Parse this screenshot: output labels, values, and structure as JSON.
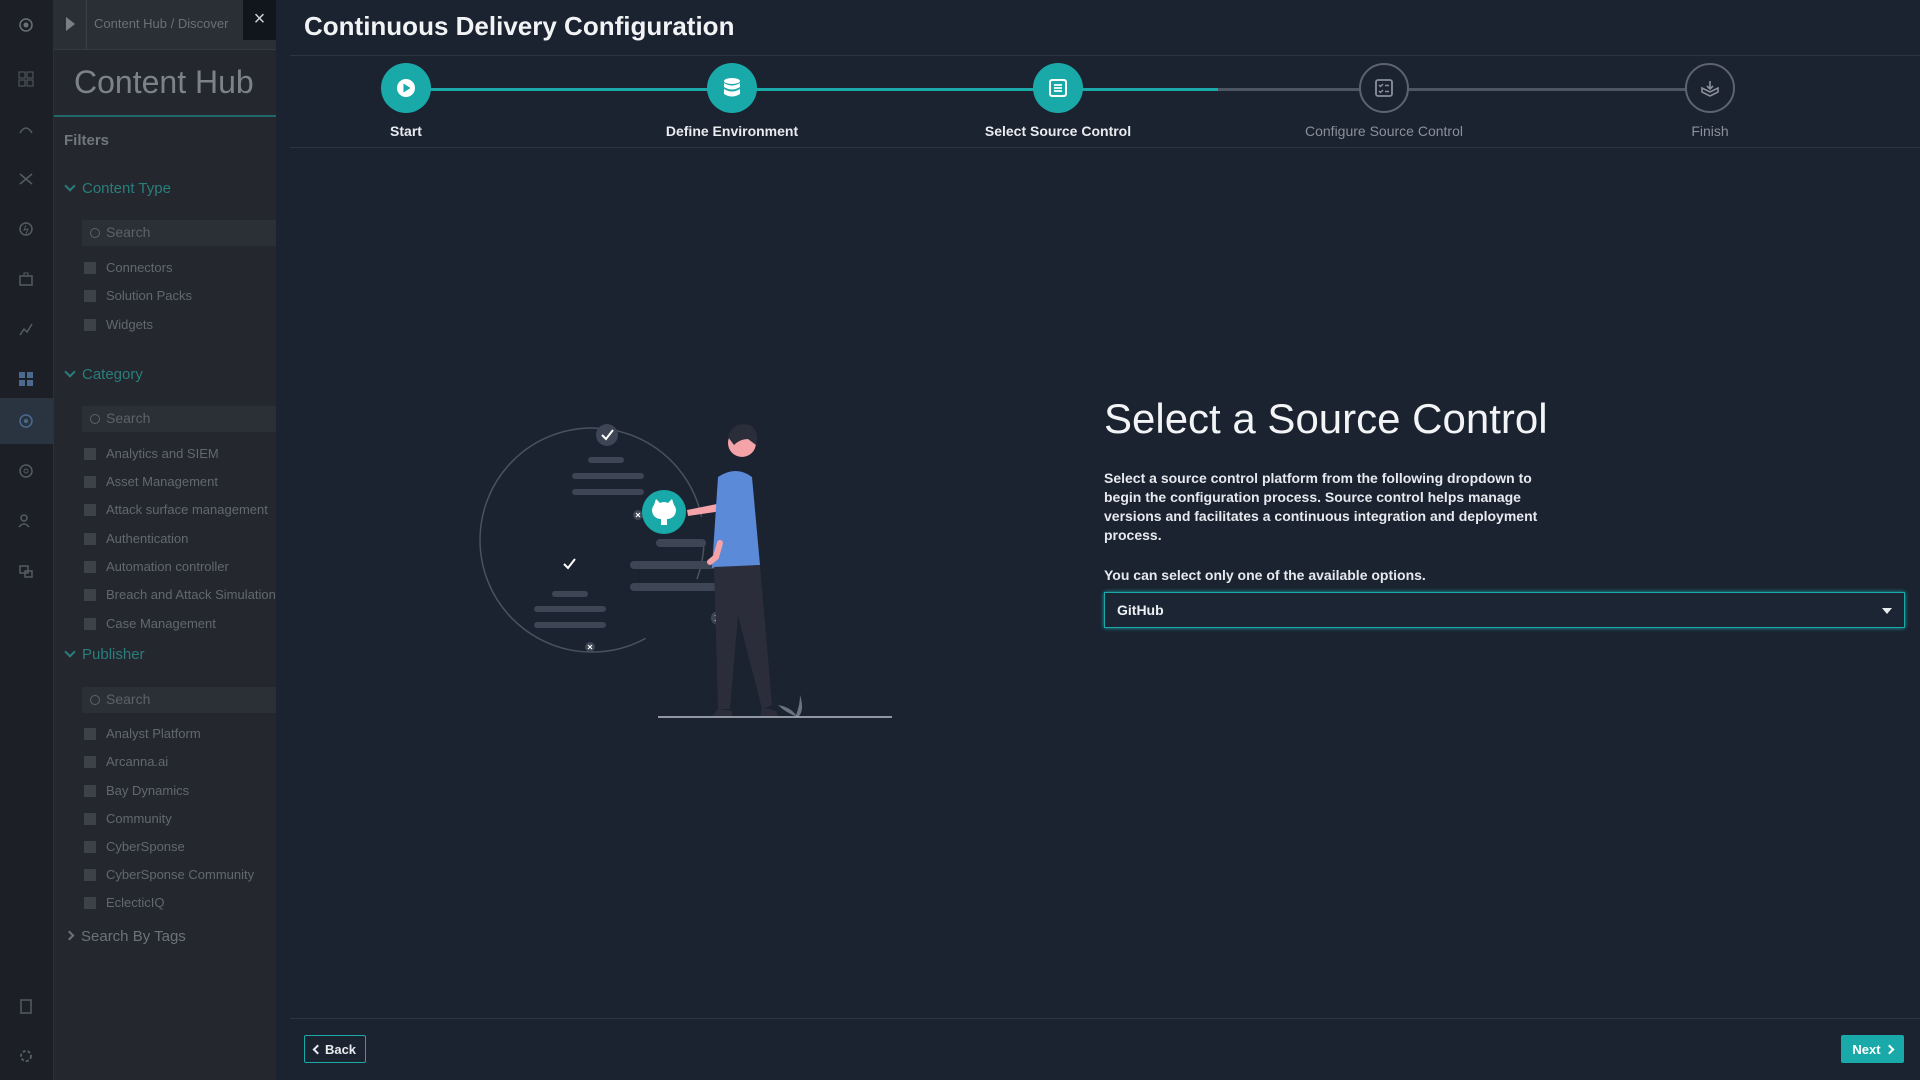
{
  "background_app": {
    "breadcrumb": "Content Hub / Discover",
    "hub_title": "Content Hub",
    "filters_label": "Filters",
    "groups": [
      {
        "label": "Content Type",
        "search_placeholder": "Search",
        "items": [
          "Connectors",
          "Solution Packs",
          "Widgets"
        ]
      },
      {
        "label": "Category",
        "search_placeholder": "Search",
        "items": [
          "Analytics and SIEM",
          "Asset Management",
          "Attack surface management",
          "Authentication",
          "Automation controller",
          "Breach and Attack Simulation",
          "Case Management"
        ]
      },
      {
        "label": "Publisher",
        "search_placeholder": "Search",
        "items": [
          "Analyst Platform",
          "Arcanna.ai",
          "Bay Dynamics",
          "Community",
          "CyberSponse",
          "CyberSponse Community",
          "EclecticIQ"
        ]
      }
    ],
    "search_by_tags": "Search By Tags"
  },
  "modal": {
    "close_icon": "×",
    "title": "Continuous Delivery Configuration",
    "steps": [
      {
        "label": "Start",
        "icon": "play-icon",
        "state": "done"
      },
      {
        "label": "Define Environment",
        "icon": "database-icon",
        "state": "done"
      },
      {
        "label": "Select Source Control",
        "icon": "list-icon",
        "state": "active"
      },
      {
        "label": "Configure Source Control",
        "icon": "checklist-icon",
        "state": "todo"
      },
      {
        "label": "Finish",
        "icon": "box-icon",
        "state": "todo"
      }
    ],
    "heading": "Select a Source Control",
    "description": "Select a source control platform from the following dropdown to begin the configuration process. Source control helps manage versions and facilitates a continuous integration and deployment process.",
    "note": "You can select only one of the available options.",
    "select_value": "GitHub",
    "back_label": "Back",
    "next_label": "Next"
  },
  "colors": {
    "accent": "#1aa9a9",
    "modal_bg": "#1b2230",
    "text": "#f1f3f5"
  }
}
